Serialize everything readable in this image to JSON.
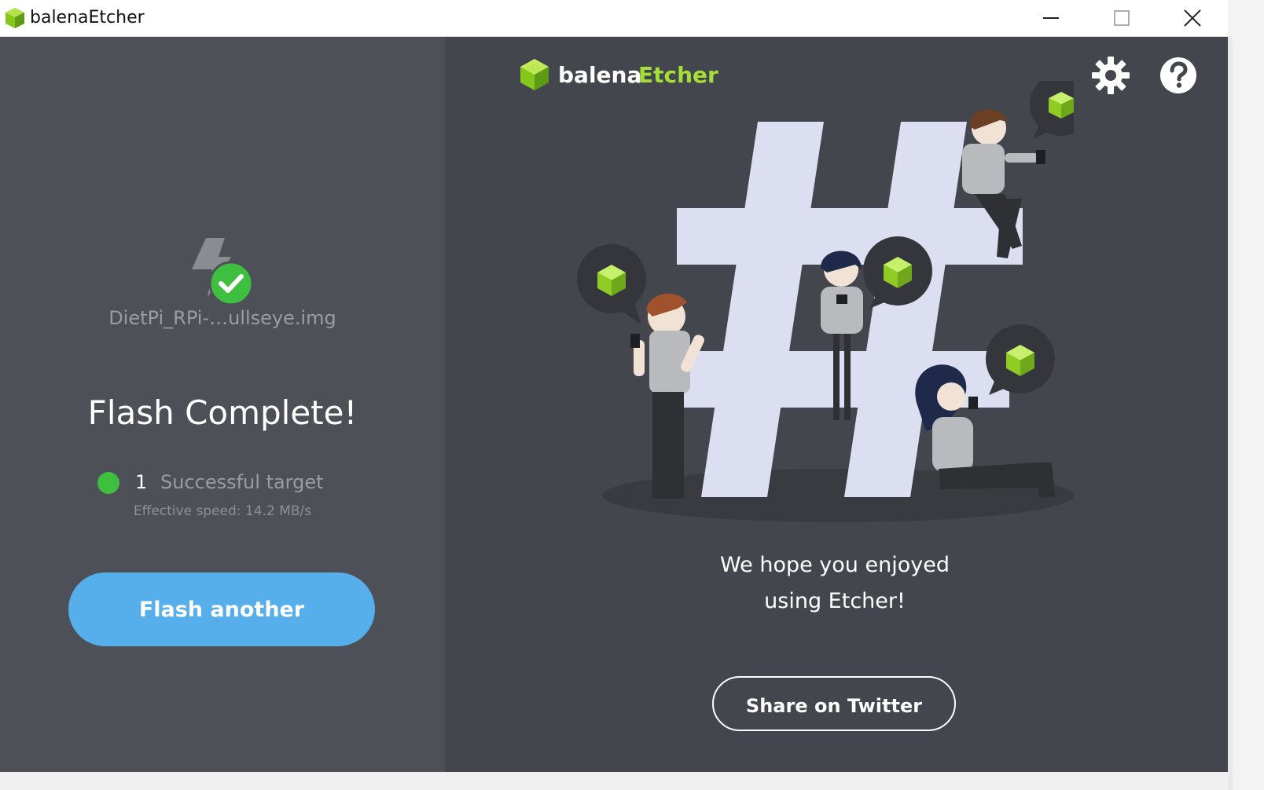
{
  "window": {
    "title": "balenaEtcher",
    "controls": [
      "minimize",
      "maximize",
      "close"
    ]
  },
  "left_panel": {
    "icon": "flash-success-icon",
    "filename": "DietPi_RPi-…ullseye.img",
    "heading": "Flash Complete!",
    "targets": {
      "count": "1",
      "label": "Successful target",
      "status_color": "#3fbf3f"
    },
    "speed": "Effective speed: 14.2 MB/s",
    "flash_another_label": "Flash another"
  },
  "right_panel": {
    "brand_part1": "balena",
    "brand_part2": "Etcher",
    "brand_accent": "#a5de37",
    "settings_icon": "gear-icon",
    "help_icon": "help-icon",
    "illustration": "hashtag-people-illustration",
    "message_line1": "We hope you enjoyed",
    "message_line2": "using Etcher!",
    "share_label": "Share on Twitter"
  },
  "colors": {
    "left_bg": "#4e5058",
    "right_bg": "#44464d",
    "primary_button": "#56aeeb"
  }
}
